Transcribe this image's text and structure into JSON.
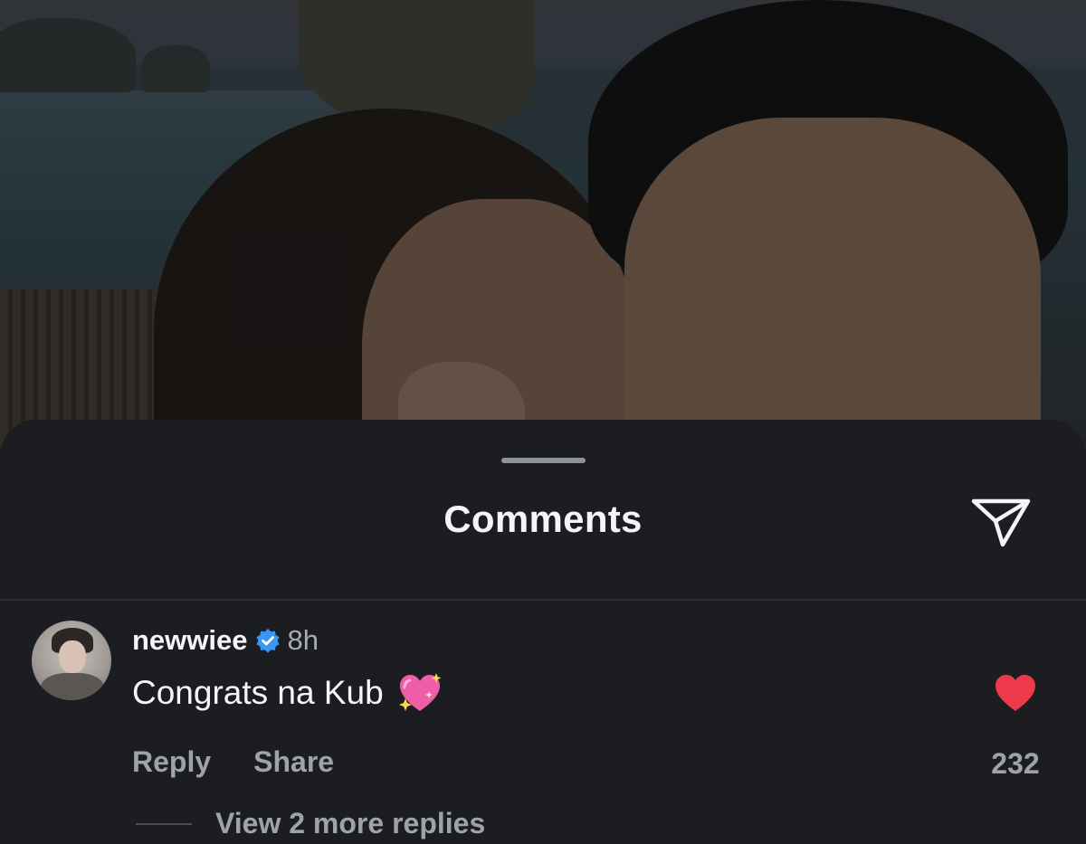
{
  "sheet": {
    "title": "Comments",
    "share_icon": "paper-plane-icon"
  },
  "comment": {
    "username": "newwiee",
    "verified": true,
    "time": "8h",
    "text": "Congrats na Kub",
    "emoji": "sparkling-heart",
    "actions": {
      "reply": "Reply",
      "share": "Share"
    },
    "likes": "232",
    "liked": true,
    "view_replies": "View 2 more replies"
  },
  "colors": {
    "sheet_bg": "#1b1d20",
    "like_red": "#ed3a4b",
    "verified_blue": "#3897f0"
  }
}
